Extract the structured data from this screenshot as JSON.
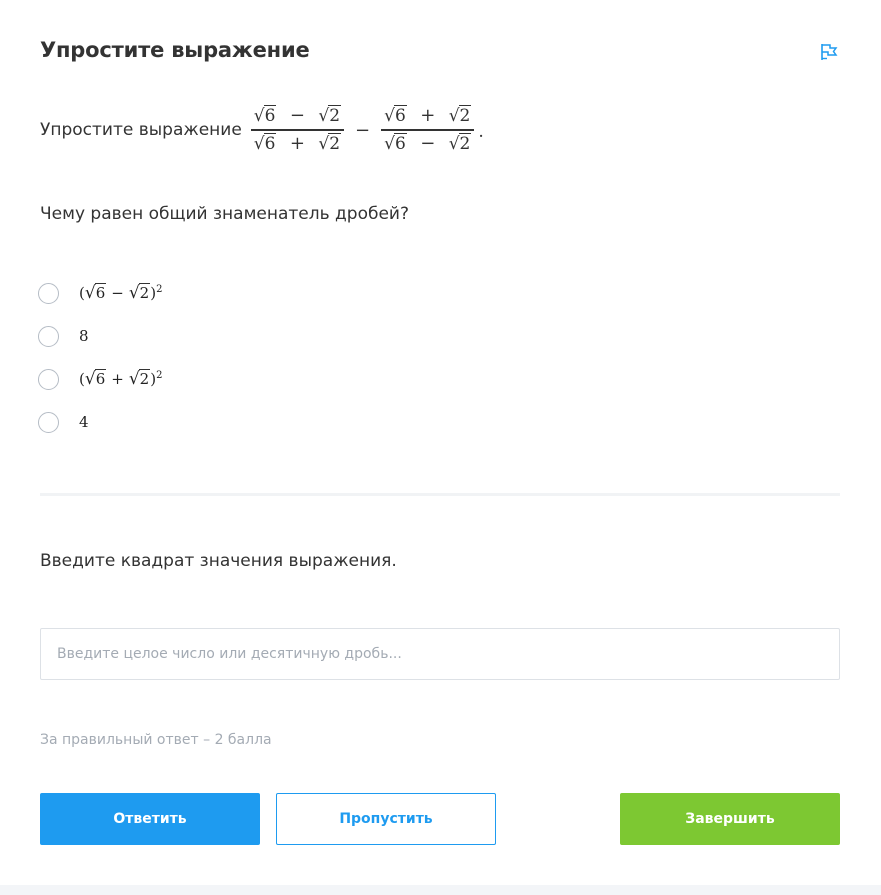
{
  "task": {
    "title": "Упростите выражение",
    "statement_lead": "Упростите выражение",
    "expression": {
      "frac1": {
        "num": [
          "6",
          "−",
          "2"
        ],
        "den": [
          "6",
          "+",
          "2"
        ]
      },
      "operator": "−",
      "frac2": {
        "num": [
          "6",
          "+",
          "2"
        ],
        "den": [
          "6",
          "−",
          "2"
        ]
      },
      "end": "."
    },
    "flag_icon": "flag-icon"
  },
  "question": {
    "text": "Чему равен общий знаменатель дробей?",
    "options": [
      {
        "type": "expr",
        "open": "(",
        "a": "6",
        "op": "−",
        "b": "2",
        "close": ")",
        "power": "2"
      },
      {
        "type": "text",
        "label": "8"
      },
      {
        "type": "expr",
        "open": "(",
        "a": "6",
        "op": "+",
        "b": "2",
        "close": ")",
        "power": "2"
      },
      {
        "type": "text",
        "label": "4"
      }
    ]
  },
  "second": {
    "prompt": "Введите квадрат значения выражения.",
    "input_placeholder": "Введите целое число или десятичную дробь...",
    "input_value": ""
  },
  "points_text": "За правильный ответ – 2 балла",
  "buttons": {
    "answer": "Ответить",
    "skip": "Пропустить",
    "finish": "Завершить"
  },
  "colors": {
    "primary": "#1e9bf0",
    "success": "#7dc832",
    "muted": "#a4abb4"
  }
}
